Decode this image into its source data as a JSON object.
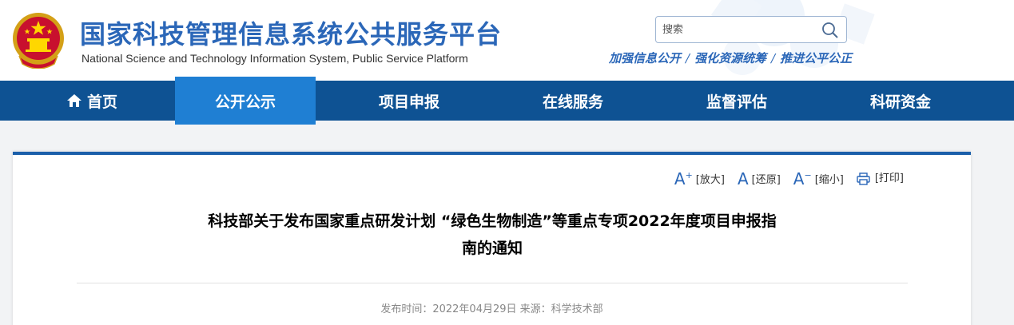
{
  "header": {
    "title_cn": "国家科技管理信息系统公共服务平台",
    "title_en": "National Science and Technology Information System, Public Service Platform",
    "emblem_icon": "national-emblem-icon",
    "search": {
      "placeholder": "搜索",
      "icon": "search-icon"
    },
    "slogan": {
      "part1": "加强信息公开",
      "sep": "/",
      "part2": "强化资源统筹",
      "part3": "推进公平公正"
    }
  },
  "nav": {
    "items": [
      {
        "label": "首页",
        "icon": "home-icon"
      },
      {
        "label": "公开公示",
        "active": true
      },
      {
        "label": "项目申报"
      },
      {
        "label": "在线服务"
      },
      {
        "label": "监督评估"
      },
      {
        "label": "科研资金"
      }
    ]
  },
  "article": {
    "tools": {
      "enlarge_glyph": "A",
      "enlarge_sup": "+",
      "enlarge_label": "[放大]",
      "reset_glyph": "A",
      "reset_label": "[还原]",
      "shrink_glyph": "A",
      "shrink_sup": "−",
      "shrink_label": "[缩小]",
      "print_label": "[打印]"
    },
    "title_line1": "科技部关于发布国家重点研发计划 “绿色生物制造”等重点专项2022年度项目申报指",
    "title_line2": "南的通知",
    "meta": "发布时间：2022年04月29日 来源：科学技术部"
  },
  "colors": {
    "brand_blue": "#2b67b8",
    "nav_bg": "#0e5293",
    "nav_active": "#1f7fd3",
    "card_border": "#1b5faa"
  }
}
